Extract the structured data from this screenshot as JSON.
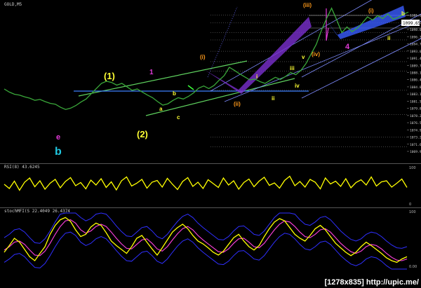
{
  "colors": {
    "background": "#000000",
    "price": "#3aa83a",
    "trendline": "#5fd35f",
    "support": "#3d7fff",
    "channel": "#7f8cff",
    "fib": "#8a8a8a",
    "rsi": "#ffff00",
    "stoch_k": "#ffff00",
    "stoch_d": "#ff3fd0",
    "bands": "#2f2fff",
    "label_yellow": "#ffff33",
    "label_orange": "#ff9a1a",
    "label_magenta": "#e23ad8",
    "label_cyan": "#20c8e0",
    "purple_zone": "#7a2fd0",
    "blue_zone": "#3a5cff"
  },
  "panes": {
    "main_title": "GOLD,M5",
    "rsi_title": "RSI(8) 43.6245",
    "stoch_title": "stochMFI(S 22.4049 26.4374"
  },
  "footer": "[1278x835] http://upic.me/",
  "chart_data": [
    {
      "type": "line",
      "name": "price",
      "title": "GOLD,M5",
      "ylim": [
        1068.5,
        1103.5
      ],
      "y_ticks": [
        "1101.30",
        "1099.65",
        "1098.00",
        "1096.35",
        "1094.70",
        "1093.05",
        "1091.40",
        "1089.75",
        "1088.10",
        "1086.45",
        "1084.80",
        "1083.15",
        "1081.50",
        "1079.85",
        "1078.20",
        "1076.55",
        "1074.90",
        "1073.25",
        "1071.60",
        "1069.95"
      ],
      "current_price": "1099.65",
      "values": [
        1084.3,
        1083.6,
        1083.1,
        1082.9,
        1082.5,
        1082.2,
        1081.7,
        1081.9,
        1081.4,
        1081.0,
        1080.8,
        1080.1,
        1079.6,
        1079.9,
        1080.5,
        1081.3,
        1082.0,
        1083.2,
        1084.4,
        1085.6,
        1086.1,
        1085.8,
        1085.2,
        1085.6,
        1084.8,
        1084.0,
        1084.3,
        1083.6,
        1082.9,
        1082.3,
        1081.4,
        1080.6,
        1080.9,
        1081.7,
        1082.3,
        1082.0,
        1082.6,
        1083.4,
        1084.5,
        1085.0,
        1084.4,
        1085.1,
        1086.3,
        1087.4,
        1089.3,
        1088.6,
        1087.8,
        1087.1,
        1086.4,
        1086.6,
        1086.0,
        1085.6,
        1086.3,
        1087.0,
        1086.5,
        1087.2,
        1088.1,
        1087.6,
        1088.6,
        1090.2,
        1092.4,
        1094.6,
        1097.8,
        1100.5,
        1102.9,
        1100.2,
        1097.3,
        1098.6,
        1097.5,
        1098.3,
        1099.5,
        1100.9,
        1100.2,
        1101.2,
        1100.5,
        1101.6,
        1100.4,
        1100.8,
        1101.5,
        1102.0
      ]
    },
    {
      "type": "line",
      "name": "RSI(8)",
      "title": "RSI(8) 43.6245",
      "ylim": [
        0,
        100
      ],
      "values": [
        52,
        40,
        61,
        35,
        58,
        70,
        45,
        62,
        38,
        55,
        66,
        42,
        60,
        71,
        48,
        57,
        39,
        64,
        50,
        68,
        43,
        59,
        36,
        62,
        73,
        47,
        55,
        66,
        41,
        58,
        63,
        44,
        69,
        52,
        37,
        60,
        71,
        46,
        58,
        40,
        65,
        54,
        43,
        70,
        50,
        62,
        38,
        57,
        67,
        45,
        61,
        72,
        49,
        56,
        41,
        63,
        75,
        48,
        60,
        44,
        66,
        58,
        39,
        70,
        53,
        61,
        46,
        68,
        42,
        57,
        65,
        50,
        73,
        47,
        59,
        62,
        44,
        55,
        67,
        43
      ]
    },
    {
      "type": "line",
      "name": "stochMFI",
      "title": "stochMFI(S 22.4049 26.4374",
      "ylim": [
        0,
        100
      ],
      "series": [
        {
          "values": [
            30,
            42,
            55,
            48,
            35,
            22,
            15,
            28,
            40,
            62,
            78,
            88,
            92,
            85,
            70,
            58,
            62,
            75,
            82,
            78,
            65,
            50,
            42,
            35,
            28,
            40,
            55,
            60,
            48,
            36,
            25,
            38,
            52,
            66,
            74,
            80,
            72,
            60,
            50,
            45,
            38,
            30,
            25,
            32,
            44,
            56,
            62,
            50,
            40,
            34,
            42,
            58,
            72,
            84,
            90,
            86,
            74,
            62,
            55,
            50,
            60,
            72,
            78,
            70,
            58,
            46,
            38,
            30,
            24,
            30,
            40,
            48,
            42,
            35,
            28,
            20,
            15,
            12,
            18,
            22
          ]
        },
        {
          "values": [
            34,
            40,
            48,
            50,
            44,
            34,
            25,
            24,
            32,
            46,
            62,
            76,
            86,
            88,
            82,
            70,
            64,
            68,
            76,
            80,
            76,
            66,
            55,
            45,
            37,
            36,
            44,
            52,
            54,
            46,
            36,
            32,
            40,
            52,
            63,
            72,
            76,
            70,
            60,
            52,
            45,
            38,
            31,
            30,
            36,
            46,
            54,
            55,
            48,
            40,
            38,
            46,
            58,
            70,
            80,
            86,
            84,
            76,
            66,
            58,
            56,
            62,
            70,
            72,
            66,
            56,
            46,
            38,
            31,
            28,
            32,
            40,
            44,
            42,
            36,
            28,
            21,
            16,
            15,
            18
          ]
        }
      ]
    }
  ],
  "annotations": {
    "wave_1": "(1)",
    "wave_2": "(2)",
    "wave_a": "a",
    "wave_b": "b",
    "wave_c": "c",
    "wave_i_small": "i",
    "wave_ii_small": "ii",
    "wave_iii_small": "iii",
    "wave_iv_small": "iv",
    "wave_v_small": "v",
    "wave_i_paren": "(i)",
    "wave_ii_paren": "(ii)",
    "wave_iv_paren": "(iv)",
    "wave_iii_paren": "(iii)",
    "wave_i_paren_top": "(i)",
    "wave_b_top": "b",
    "wave_ii_right": "ii",
    "mag_1": "1",
    "mag_4": "4",
    "mag_e": "e",
    "cyan_b": "b"
  }
}
